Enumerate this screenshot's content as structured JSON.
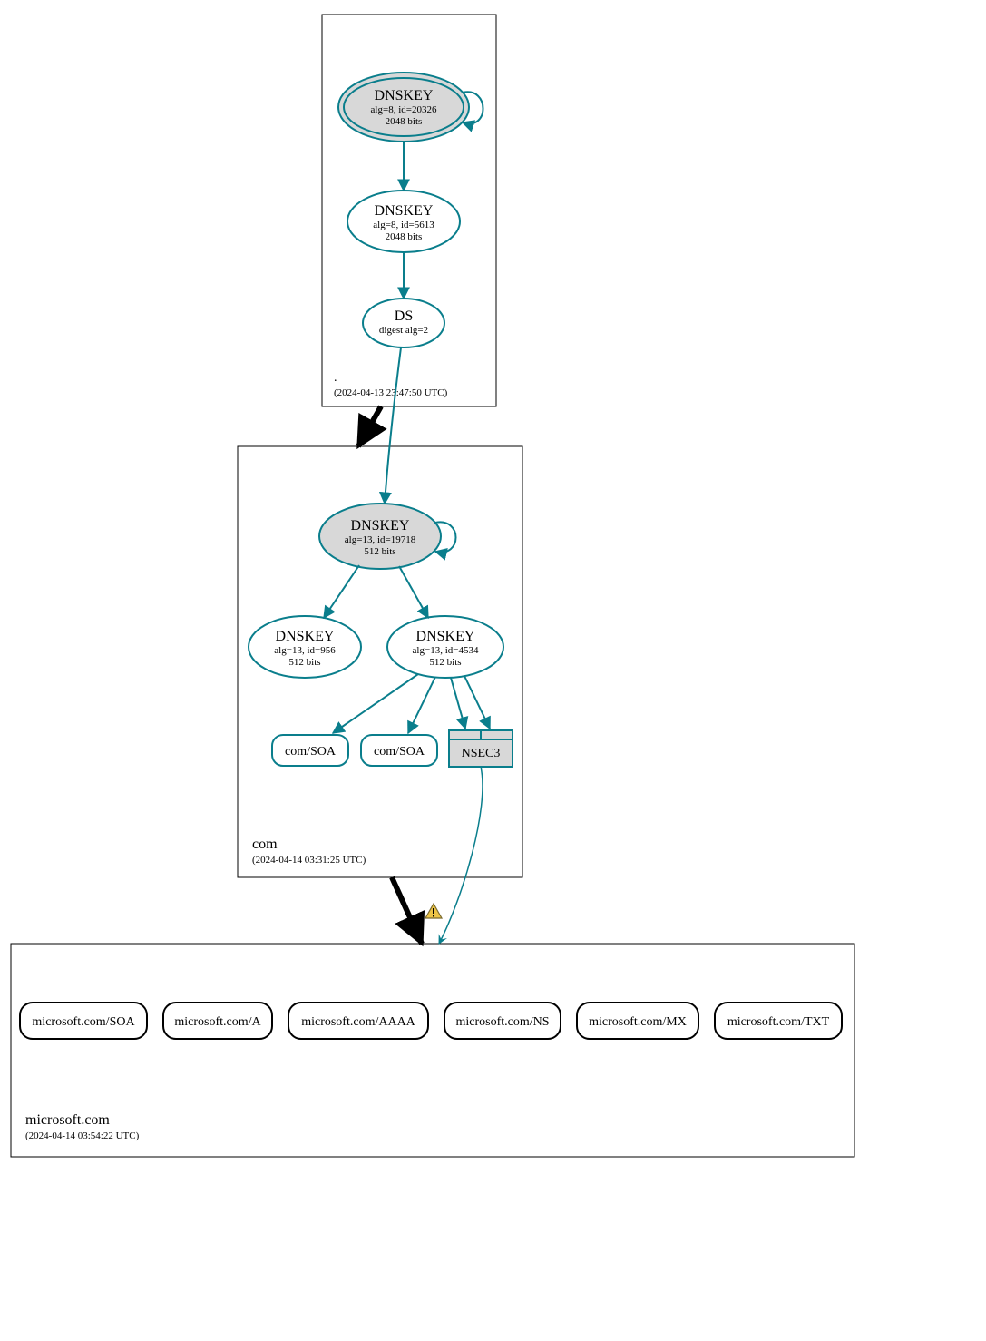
{
  "colors": {
    "teal": "#0a7e8c",
    "fill_grey": "#d8d8d8",
    "nsec_fill": "#d8d8d8",
    "black": "#000000",
    "white": "#ffffff",
    "warning_fill": "#ecc447",
    "warning_stroke": "#7a6a2f"
  },
  "zones": {
    "root": {
      "label": ".",
      "timestamp": "(2024-04-13 23:47:50 UTC)"
    },
    "com": {
      "label": "com",
      "timestamp": "(2024-04-14 03:31:25 UTC)"
    },
    "microsoft": {
      "label": "microsoft.com",
      "timestamp": "(2024-04-14 03:54:22 UTC)"
    }
  },
  "nodes": {
    "root_ksk": {
      "title": "DNSKEY",
      "sub1": "alg=8, id=20326",
      "sub2": "2048 bits"
    },
    "root_zsk": {
      "title": "DNSKEY",
      "sub1": "alg=8, id=5613",
      "sub2": "2048 bits"
    },
    "root_ds": {
      "title": "DS",
      "sub1": "digest alg=2"
    },
    "com_ksk": {
      "title": "DNSKEY",
      "sub1": "alg=13, id=19718",
      "sub2": "512 bits"
    },
    "com_zsk1": {
      "title": "DNSKEY",
      "sub1": "alg=13, id=956",
      "sub2": "512 bits"
    },
    "com_zsk2": {
      "title": "DNSKEY",
      "sub1": "alg=13, id=4534",
      "sub2": "512 bits"
    },
    "com_soa1": "com/SOA",
    "com_soa2": "com/SOA",
    "com_nsec3": "NSEC3",
    "ms_soa": "microsoft.com/SOA",
    "ms_a": "microsoft.com/A",
    "ms_aaaa": "microsoft.com/AAAA",
    "ms_ns": "microsoft.com/NS",
    "ms_mx": "microsoft.com/MX",
    "ms_txt": "microsoft.com/TXT"
  }
}
